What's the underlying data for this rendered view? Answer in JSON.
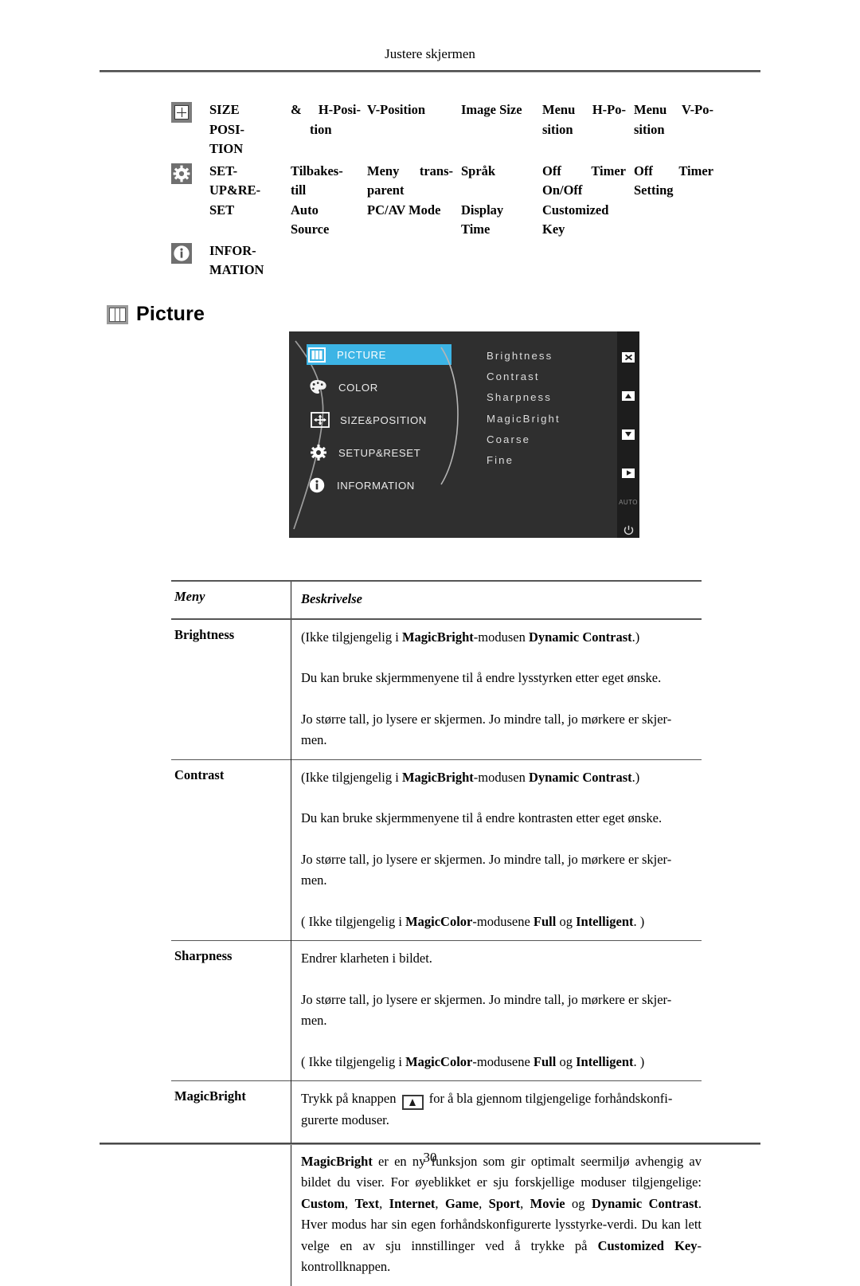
{
  "header": {
    "running_title": "Justere skjermen"
  },
  "top_table": {
    "rows": [
      {
        "icon": "size-position-icon",
        "name": "SIZE & POSI-TION",
        "name_lines": [
          "SIZE",
          "POSI-",
          "TION"
        ],
        "amp": "&",
        "lines": [
          {
            "c1": "H-Posi-",
            "c1b": "tion",
            "c2": "V-Position",
            "c3": "Image Size",
            "c4a": "Menu",
            "c4b": "H-Po-",
            "c4c": "sition",
            "c5a": "Menu",
            "c5b": "V-Po-",
            "c5c": "sition"
          }
        ]
      },
      {
        "icon": "gear-icon",
        "name_lines": [
          "SET-",
          "UP&RE-",
          "SET"
        ],
        "line1": {
          "c1a": "Tilbakes-",
          "c1b": "till",
          "c2a": "Meny",
          "c2b": "trans-",
          "c2c": "parent",
          "c3": "Språk",
          "c4a": "Off",
          "c4b": "Timer",
          "c4c": "On/Off",
          "c5a": "Off",
          "c5b": "Timer",
          "c5c": "Setting"
        },
        "line2": {
          "c1a": "Auto",
          "c1b": "Source",
          "c2": "PC/AV Mode",
          "c3a": "Display",
          "c3b": "Time",
          "c4a": "Customized",
          "c4b": "Key"
        }
      },
      {
        "icon": "information-icon",
        "name_lines": [
          "INFOR-",
          "MATION"
        ]
      }
    ]
  },
  "section": {
    "icon": "picture-icon",
    "title": "Picture"
  },
  "osd": {
    "menu_items": [
      {
        "icon": "picture-icon",
        "label": "PICTURE",
        "selected": true
      },
      {
        "icon": "color-icon",
        "label": "COLOR",
        "selected": false
      },
      {
        "icon": "size-position-icon",
        "label": "SIZE&POSITION",
        "selected": false
      },
      {
        "icon": "gear-icon",
        "label": "SETUP&RESET",
        "selected": false
      },
      {
        "icon": "information-icon",
        "label": "INFORMATION",
        "selected": false
      }
    ],
    "submenu_items": [
      "Brightness",
      "Contrast",
      "Sharpness",
      "MagicBright",
      "Coarse",
      "Fine"
    ],
    "side_buttons": [
      {
        "icon": "close-icon",
        "glyph": "✕"
      },
      {
        "icon": "up-arrow-icon",
        "glyph": "▲"
      },
      {
        "icon": "down-arrow-icon",
        "glyph": "▼"
      },
      {
        "icon": "enter-arrow-icon",
        "glyph": "▶"
      },
      {
        "icon": "auto-label",
        "glyph": "AUTO"
      },
      {
        "icon": "power-icon",
        "glyph": "⏻"
      }
    ],
    "highlight_color": "#3cb4e5",
    "background_color": "#2f2f2f",
    "sidebar_color": "#1d1d1d"
  },
  "desc_table": {
    "headers": {
      "menu": "Meny",
      "description": "Beskrivelse"
    },
    "rows": [
      {
        "name": "Brightness",
        "paragraphs": [
          {
            "parts": [
              {
                "t": "(Ikke tilgjengelig i ",
                "b": false
              },
              {
                "t": "MagicBright",
                "b": true
              },
              {
                "t": "-modusen ",
                "b": false
              },
              {
                "t": "Dynamic Contrast",
                "b": true
              },
              {
                "t": ".)",
                "b": false
              }
            ]
          },
          {
            "parts": [
              {
                "t": "Du kan bruke skjermmenyene til å endre lysstyrken etter eget ønske.",
                "b": false
              }
            ]
          },
          {
            "parts": [
              {
                "t": "Jo større tall, jo lysere er skjermen. Jo mindre tall, jo mørkere er skjer-men.",
                "b": false
              }
            ]
          }
        ]
      },
      {
        "name": "Contrast",
        "paragraphs": [
          {
            "parts": [
              {
                "t": "(Ikke tilgjengelig i ",
                "b": false
              },
              {
                "t": "MagicBright",
                "b": true
              },
              {
                "t": "-modusen ",
                "b": false
              },
              {
                "t": "Dynamic Contrast",
                "b": true
              },
              {
                "t": ".)",
                "b": false
              }
            ]
          },
          {
            "parts": [
              {
                "t": "Du kan bruke skjermmenyene til å endre kontrasten etter eget ønske.",
                "b": false
              }
            ]
          },
          {
            "parts": [
              {
                "t": "Jo større tall, jo lysere er skjermen. Jo mindre tall, jo mørkere er skjer-men.",
                "b": false
              }
            ]
          },
          {
            "parts": [
              {
                "t": "( Ikke tilgjengelig i ",
                "b": false
              },
              {
                "t": "MagicColor",
                "b": true
              },
              {
                "t": "-modusene ",
                "b": false
              },
              {
                "t": "Full",
                "b": true
              },
              {
                "t": " og ",
                "b": false
              },
              {
                "t": "Intelligent",
                "b": true
              },
              {
                "t": ". )",
                "b": false
              }
            ]
          }
        ]
      },
      {
        "name": "Sharpness",
        "paragraphs": [
          {
            "parts": [
              {
                "t": "Endrer klarheten i bildet.",
                "b": false
              }
            ]
          },
          {
            "parts": [
              {
                "t": "Jo større tall, jo lysere er skjermen. Jo mindre tall, jo mørkere er skjer-men.",
                "b": false
              }
            ]
          },
          {
            "parts": [
              {
                "t": "( Ikke tilgjengelig i ",
                "b": false
              },
              {
                "t": "MagicColor",
                "b": true
              },
              {
                "t": "-modusene ",
                "b": false
              },
              {
                "t": "Full",
                "b": true
              },
              {
                "t": " og ",
                "b": false
              },
              {
                "t": "Intelligent",
                "b": true
              },
              {
                "t": ". )",
                "b": false
              }
            ]
          }
        ]
      },
      {
        "name": "MagicBright",
        "paragraphs": [
          {
            "parts": [
              {
                "t": "Trykk på knappen ",
                "b": false
              },
              {
                "icon": "customized-key-icon"
              },
              {
                "t": " for å bla gjennom tilgjengelige forhåndskonfi-gurerte moduser.",
                "b": false
              }
            ]
          },
          {
            "parts": [
              {
                "t": "MagicBright",
                "b": true
              },
              {
                "t": " er en ny funksjon som gir optimalt seermiljø avhengig av bildet du viser. For øyeblikket er sju forskjellige moduser tilgjengelige: ",
                "b": false
              },
              {
                "t": "Custom",
                "b": true
              },
              {
                "t": ", ",
                "b": false
              },
              {
                "t": "Text",
                "b": true
              },
              {
                "t": ", ",
                "b": false
              },
              {
                "t": "Internet",
                "b": true
              },
              {
                "t": ", ",
                "b": false
              },
              {
                "t": "Game",
                "b": true
              },
              {
                "t": ", ",
                "b": false
              },
              {
                "t": "Sport",
                "b": true
              },
              {
                "t": ", ",
                "b": false
              },
              {
                "t": "Movie",
                "b": true
              },
              {
                "t": " og ",
                "b": false
              },
              {
                "t": "Dynamic Contrast",
                "b": true
              },
              {
                "t": ". Hver modus har sin egen forhåndskonfigurerte lysstyrke-verdi. Du kan lett velge en av sju innstillinger ved å trykke på ",
                "b": false
              },
              {
                "t": "Customized Key",
                "b": true
              },
              {
                "t": "-kontrollknappen.",
                "b": false
              }
            ]
          }
        ]
      }
    ]
  },
  "footer": {
    "page_number": "30"
  }
}
